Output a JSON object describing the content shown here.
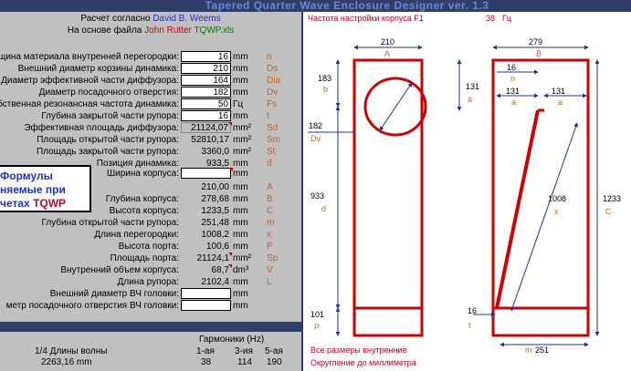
{
  "title": "Tapered Quarter Wave Enclosure Designer ver. 1.3",
  "header": {
    "line1_prefix": "Расчет согласно",
    "line1_author": "David B. Weems",
    "line2_prefix": "На основе файла",
    "line2_author": "John Rutter",
    "line2_file": "TQWP.xls"
  },
  "inputs": [
    {
      "label": "щина материала внутренней перегородки:",
      "value": "16",
      "unit": "mm",
      "sym": "n",
      "style": "box"
    },
    {
      "label": "Внешний диаметр корзины динамика:",
      "value": "210",
      "unit": "mm",
      "sym": "Ds",
      "style": "box"
    },
    {
      "label": "Диаметр эффективной части диффузора:",
      "value": "164",
      "unit": "mm",
      "sym": "Dia",
      "style": "box"
    },
    {
      "label": "Диаметр посадочного отверстия:",
      "value": "182",
      "unit": "mm",
      "sym": "Dv",
      "style": "box"
    },
    {
      "label": "обственная резонансная частота динамика:",
      "value": "50",
      "unit": "Гц",
      "sym": "Fs",
      "style": "box"
    },
    {
      "label": "Глубина закрытой части рупора:",
      "value": "16",
      "unit": "mm",
      "sym": "t",
      "style": "box"
    },
    {
      "label": "Эффективная площадь диффузора:",
      "value": "21124,07",
      "unit": "mm²",
      "sym": "Sd",
      "style": "grey"
    },
    {
      "label": "Площадь открытой части рупора:",
      "value": "52810,17",
      "unit": "mm²",
      "sym": "Sm",
      "style": "plain"
    },
    {
      "label": "Площадь закрытой части рупора:",
      "value": "3360,0",
      "unit": "mm²",
      "sym": "St",
      "style": "plain"
    },
    {
      "label": "Позиция динамика:",
      "value": "933,5",
      "unit": "mm",
      "sym": "d",
      "style": "plain"
    }
  ],
  "formula_note": {
    "line1": "Формулы",
    "line2": "няемые при",
    "line3_prefix": "четах",
    "line3_name": "TQWP"
  },
  "results": [
    {
      "label": "Ширина корпуса:",
      "value": "",
      "unit": "mm",
      "sym": "",
      "style": "box"
    },
    {
      "label": "",
      "value": "210,00",
      "unit": "mm",
      "sym": "A",
      "style": "plain"
    },
    {
      "label": "Глубина корпуса:",
      "value": "278,68",
      "unit": "mm",
      "sym": "B",
      "style": "plain"
    },
    {
      "label": "Высота корпуса:",
      "value": "1233,5",
      "unit": "mm",
      "sym": "C",
      "style": "plain"
    },
    {
      "label": "Глубина открытой части рупора:",
      "value": "251,48",
      "unit": "mm",
      "sym": "m",
      "style": "plain"
    },
    {
      "label": "Длина перегородки:",
      "value": "1008,2",
      "unit": "mm",
      "sym": "x",
      "style": "plain"
    },
    {
      "label": "Высота порта:",
      "value": "100,6",
      "unit": "mm",
      "sym": "P",
      "style": "plain"
    },
    {
      "label": "Площадь порта:",
      "value": "21124,1",
      "unit": "mm²",
      "sym": "Sp",
      "style": "plain"
    },
    {
      "label": "Внутренний объем корпуса:",
      "value": "68,7",
      "unit": "dm³",
      "sym": "V",
      "style": "plain"
    },
    {
      "label": "Длина рупора:",
      "value": "2102,4",
      "unit": "mm",
      "sym": "L",
      "style": "plain"
    },
    {
      "label": "Внешний диаметр ВЧ головки:",
      "value": "",
      "unit": "mm",
      "sym": "",
      "style": "box"
    },
    {
      "label": "метр посадочного отверстия ВЧ головки:",
      "value": "",
      "unit": "mm",
      "sym": "",
      "style": "box"
    }
  ],
  "harmonics": {
    "heading": "Гармоники (Hz)",
    "col1": "1-ая",
    "col2": "3-ия",
    "col3": "5-ая",
    "label": "1/4 Длины волны",
    "wavelength": "2263,16 mm",
    "h1": "38",
    "h3": "114",
    "h5": "190"
  },
  "drawing": {
    "tuning_label": "Частота настройки корпуса F1",
    "tuning_value": "38",
    "tuning_unit": "Гц",
    "front": {
      "width": "210",
      "sym_a": "A",
      "b_val": "183",
      "b_sym": "b",
      "dv_val": "182",
      "dv_sym": "Dv",
      "d_val": "933",
      "d_sym": "d",
      "p_val": "101",
      "p_sym": "P"
    },
    "side": {
      "depth": "279",
      "sym_b": "B",
      "n_val": "16",
      "n_sym": "n",
      "a1_val": "131",
      "a2_val": "131",
      "a3_val": "131",
      "a_sym": "a",
      "x_val": "1008",
      "x_sym": "x",
      "c_val": "1233",
      "c_sym": "C",
      "t_val": "16",
      "t_sym": "t",
      "m_val": "251",
      "m_sym": "m"
    },
    "note1": "Все размеры внутренние",
    "note2": "Округление до миллиметра"
  }
}
